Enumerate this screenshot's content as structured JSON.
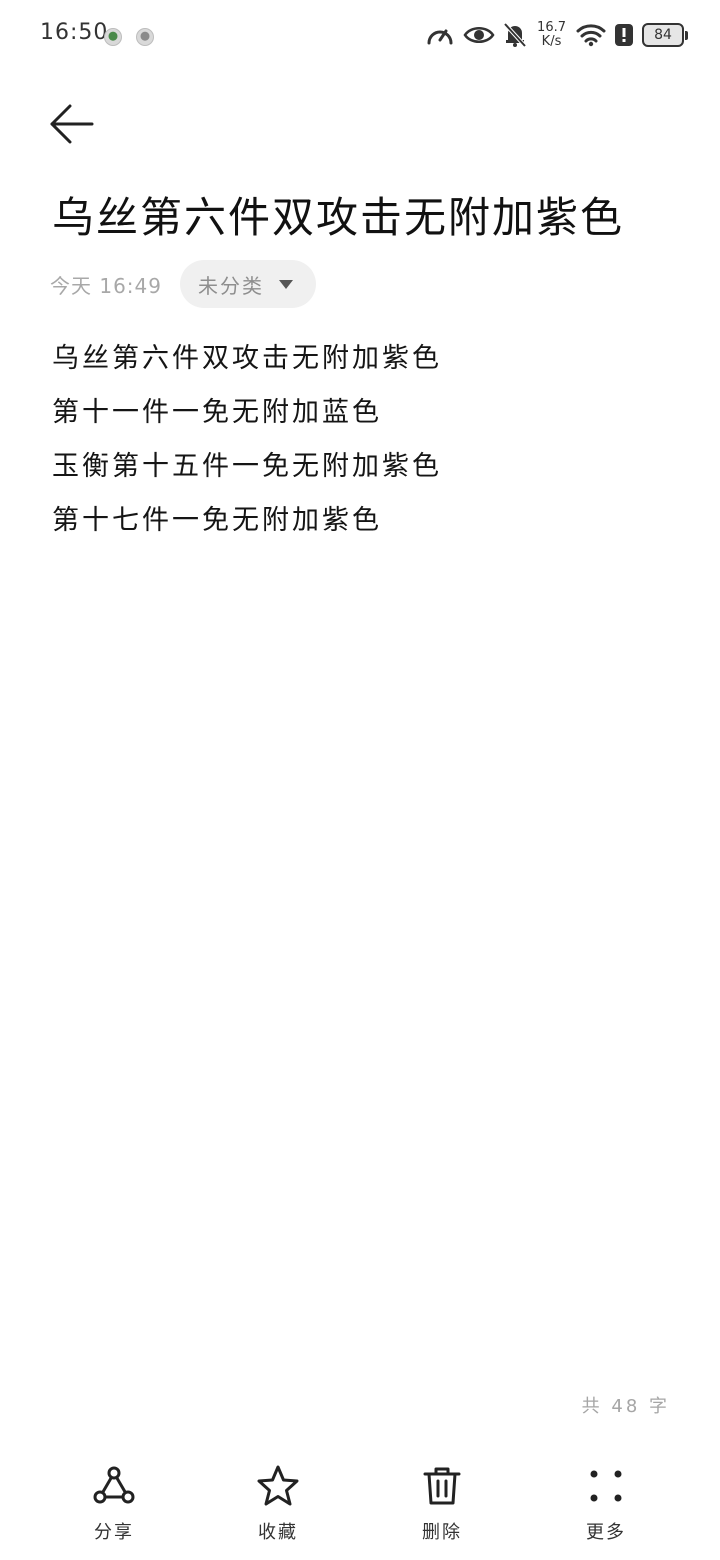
{
  "status_bar": {
    "time": "16:50",
    "speed_value": "16.7",
    "speed_unit": "K/s",
    "battery": "84",
    "icons": [
      "notification-app-icon",
      "notification-app-icon",
      "speedometer-icon",
      "eye-icon",
      "bell-off-icon",
      "wifi-icon",
      "alert-icon",
      "battery-icon"
    ]
  },
  "header": {
    "back_icon": "arrow-left-icon"
  },
  "note": {
    "title": "乌丝第六件双攻击无附加紫色",
    "date": "今天 16:49",
    "category": "未分类",
    "lines": [
      "乌丝第六件双攻击无附加紫色",
      "第十一件一免无附加蓝色",
      "玉衡第十五件一免无附加紫色",
      "第十七件一免无附加紫色"
    ],
    "word_count": "共 48 字"
  },
  "bottom_bar": {
    "items": [
      {
        "label": "分享",
        "icon": "share-icon"
      },
      {
        "label": "收藏",
        "icon": "star-icon"
      },
      {
        "label": "删除",
        "icon": "trash-icon"
      },
      {
        "label": "更多",
        "icon": "more-dots-icon"
      }
    ]
  }
}
